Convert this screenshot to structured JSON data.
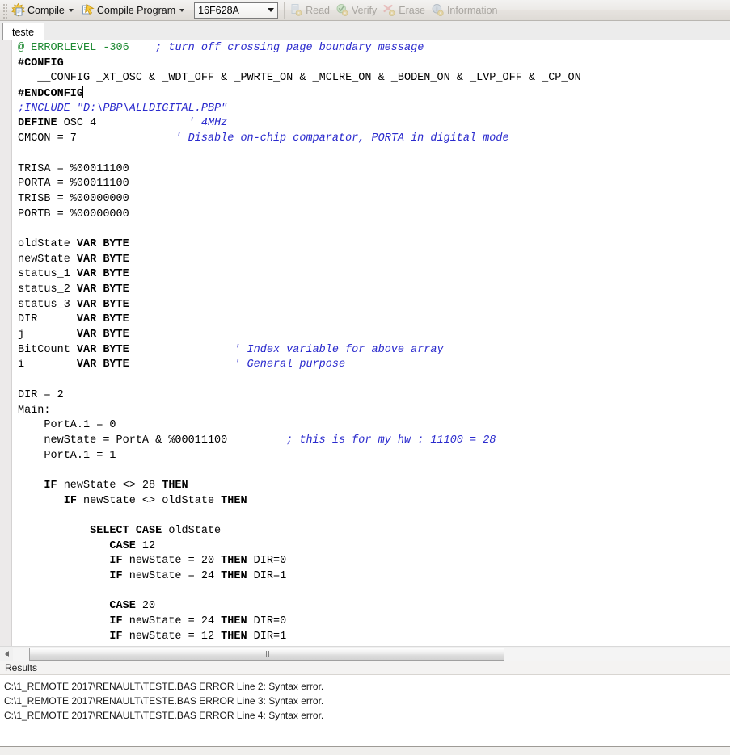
{
  "toolbar": {
    "compile": {
      "label": "Compile",
      "icon": "compile-burst-icon",
      "enabled": true,
      "has_dropdown": true
    },
    "compile_program": {
      "label": "Compile Program",
      "icon": "compile-program-arrow-icon",
      "enabled": true,
      "has_dropdown": true
    },
    "device_combo": {
      "value": "16F628A",
      "placeholder": "16F628A",
      "icon": "chevron-down-icon"
    },
    "read": {
      "label": "Read",
      "icon": "read-page-icon",
      "enabled": false
    },
    "verify": {
      "label": "Verify",
      "icon": "verify-check-icon",
      "enabled": false
    },
    "erase": {
      "label": "Erase",
      "icon": "erase-brush-icon",
      "enabled": false
    },
    "information": {
      "label": "Information",
      "icon": "information-icon",
      "enabled": false
    }
  },
  "tabs": [
    {
      "label": "teste",
      "active": true
    }
  ],
  "editor": {
    "filename": "teste",
    "cursor_line": 4,
    "margin_column_x": 822,
    "colors": {
      "text": "#000000",
      "comment": "#2a2acd",
      "directive": "#1e8a32",
      "background": "#ffffff",
      "gutter": "#eceaea",
      "margin_guide": "#b5b5b5"
    },
    "lines": [
      {
        "segments": [
          {
            "t": "@ ERRORLEVEL -306",
            "s": "gr"
          },
          {
            "t": "    "
          },
          {
            "t": "; turn off crossing page boundary message",
            "s": "cm"
          }
        ]
      },
      {
        "segments": [
          {
            "t": "#CONFIG",
            "s": "b"
          }
        ]
      },
      {
        "segments": [
          {
            "t": "   __CONFIG _XT_OSC & _WDT_OFF & _PWRTE_ON & _MCLRE_ON & _BODEN_ON & _LVP_OFF & _CP_ON"
          }
        ]
      },
      {
        "segments": [
          {
            "t": "#ENDCONFIG",
            "s": "b"
          },
          {
            "t": "",
            "s": "caret"
          }
        ]
      },
      {
        "segments": [
          {
            "t": ";INCLUDE \"D:\\PBP\\ALLDIGITAL.PBP\"",
            "s": "cm"
          }
        ]
      },
      {
        "segments": [
          {
            "t": "DEFINE",
            "s": "b"
          },
          {
            "t": " OSC 4              "
          },
          {
            "t": "' 4MHz",
            "s": "cm"
          }
        ]
      },
      {
        "segments": [
          {
            "t": "CMCON = 7               "
          },
          {
            "t": "' Disable on-chip comparator, PORTA in digital mode",
            "s": "cm"
          }
        ]
      },
      {
        "segments": [
          {
            "t": ""
          }
        ]
      },
      {
        "segments": [
          {
            "t": "TRISA = %00011100"
          }
        ]
      },
      {
        "segments": [
          {
            "t": "PORTA = %00011100"
          }
        ]
      },
      {
        "segments": [
          {
            "t": "TRISB = %00000000"
          }
        ]
      },
      {
        "segments": [
          {
            "t": "PORTB = %00000000"
          }
        ]
      },
      {
        "segments": [
          {
            "t": ""
          }
        ]
      },
      {
        "segments": [
          {
            "t": "oldState "
          },
          {
            "t": "VAR BYTE",
            "s": "b"
          }
        ]
      },
      {
        "segments": [
          {
            "t": "newState "
          },
          {
            "t": "VAR BYTE",
            "s": "b"
          }
        ]
      },
      {
        "segments": [
          {
            "t": "status_1 "
          },
          {
            "t": "VAR BYTE",
            "s": "b"
          }
        ]
      },
      {
        "segments": [
          {
            "t": "status_2 "
          },
          {
            "t": "VAR BYTE",
            "s": "b"
          }
        ]
      },
      {
        "segments": [
          {
            "t": "status_3 "
          },
          {
            "t": "VAR BYTE",
            "s": "b"
          }
        ]
      },
      {
        "segments": [
          {
            "t": "DIR      "
          },
          {
            "t": "VAR BYTE",
            "s": "b"
          }
        ]
      },
      {
        "segments": [
          {
            "t": "j        "
          },
          {
            "t": "VAR BYTE",
            "s": "b"
          }
        ]
      },
      {
        "segments": [
          {
            "t": "BitCount "
          },
          {
            "t": "VAR BYTE",
            "s": "b"
          },
          {
            "t": "                "
          },
          {
            "t": "' Index variable for above array",
            "s": "cm"
          }
        ]
      },
      {
        "segments": [
          {
            "t": "i        "
          },
          {
            "t": "VAR BYTE",
            "s": "b"
          },
          {
            "t": "                "
          },
          {
            "t": "' General purpose",
            "s": "cm"
          }
        ]
      },
      {
        "segments": [
          {
            "t": ""
          }
        ]
      },
      {
        "segments": [
          {
            "t": "DIR = 2"
          }
        ]
      },
      {
        "segments": [
          {
            "t": "Main:"
          }
        ]
      },
      {
        "segments": [
          {
            "t": "    PortA.1 = 0"
          }
        ]
      },
      {
        "segments": [
          {
            "t": "    newState = PortA & %00011100         "
          },
          {
            "t": "; this is for my hw : 11100 = 28",
            "s": "cm"
          }
        ]
      },
      {
        "segments": [
          {
            "t": "    PortA.1 = 1"
          }
        ]
      },
      {
        "segments": [
          {
            "t": ""
          }
        ]
      },
      {
        "segments": [
          {
            "t": "    "
          },
          {
            "t": "IF",
            "s": "b"
          },
          {
            "t": " newState <> 28 "
          },
          {
            "t": "THEN",
            "s": "b"
          }
        ]
      },
      {
        "segments": [
          {
            "t": "       "
          },
          {
            "t": "IF",
            "s": "b"
          },
          {
            "t": " newState <> oldState "
          },
          {
            "t": "THEN",
            "s": "b"
          }
        ]
      },
      {
        "segments": [
          {
            "t": ""
          }
        ]
      },
      {
        "segments": [
          {
            "t": "           "
          },
          {
            "t": "SELECT CASE",
            "s": "b"
          },
          {
            "t": " oldState"
          }
        ]
      },
      {
        "segments": [
          {
            "t": "              "
          },
          {
            "t": "CASE",
            "s": "b"
          },
          {
            "t": " 12"
          }
        ]
      },
      {
        "segments": [
          {
            "t": "              "
          },
          {
            "t": "IF",
            "s": "b"
          },
          {
            "t": " newState = 20 "
          },
          {
            "t": "THEN",
            "s": "b"
          },
          {
            "t": " DIR=0"
          }
        ]
      },
      {
        "segments": [
          {
            "t": "              "
          },
          {
            "t": "IF",
            "s": "b"
          },
          {
            "t": " newState = 24 "
          },
          {
            "t": "THEN",
            "s": "b"
          },
          {
            "t": " DIR=1"
          }
        ]
      },
      {
        "segments": [
          {
            "t": ""
          }
        ]
      },
      {
        "segments": [
          {
            "t": "              "
          },
          {
            "t": "CASE",
            "s": "b"
          },
          {
            "t": " 20"
          }
        ]
      },
      {
        "segments": [
          {
            "t": "              "
          },
          {
            "t": "IF",
            "s": "b"
          },
          {
            "t": " newState = 24 "
          },
          {
            "t": "THEN",
            "s": "b"
          },
          {
            "t": " DIR=0"
          }
        ]
      },
      {
        "segments": [
          {
            "t": "              "
          },
          {
            "t": "IF",
            "s": "b"
          },
          {
            "t": " newState = 12 "
          },
          {
            "t": "THEN",
            "s": "b"
          },
          {
            "t": " DIR=1"
          }
        ]
      }
    ]
  },
  "hscroll": {
    "left_arrow_icon": "triangle-left-icon",
    "thumb_grip_icon": "grip-dots-icon"
  },
  "results": {
    "header": "Results",
    "rows": [
      "C:\\1_REMOTE 2017\\RENAULT\\TESTE.BAS ERROR Line 2: Syntax error.",
      "C:\\1_REMOTE 2017\\RENAULT\\TESTE.BAS ERROR Line 3: Syntax error.",
      "C:\\1_REMOTE 2017\\RENAULT\\TESTE.BAS ERROR Line 4: Syntax error."
    ]
  }
}
